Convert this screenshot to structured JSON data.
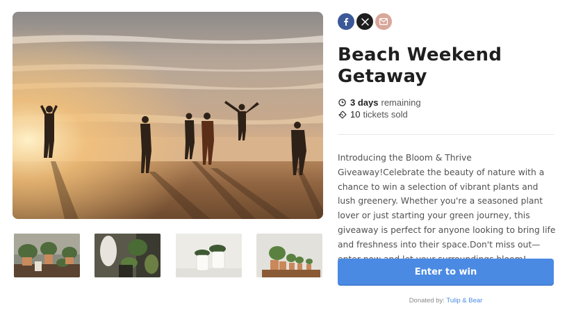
{
  "listing": {
    "title": "Beach Weekend Getaway",
    "time_value": "3 days",
    "time_suffix": "remaining",
    "tickets_value": "10",
    "tickets_suffix": "tickets sold",
    "description": "Introducing the Bloom & Thrive Giveaway!Celebrate the beauty of nature with a chance to win a selection of vibrant plants and lush greenery. Whether you're a seasoned plant lover or just starting your green journey, this giveaway is perfect for anyone looking to bring life and freshness into their space.Don't miss out—enter now and let your surroundings bloom!",
    "cta_label": "Enter to win",
    "donated_prefix": "Donated by:",
    "donor_name": "Tulip & Bear"
  },
  "share": {
    "buttons": [
      {
        "icon": "facebook-icon",
        "color": "#3b5998"
      },
      {
        "icon": "x-icon",
        "color": "#1e1e1e"
      },
      {
        "icon": "email-icon",
        "color": "#d9a79a"
      }
    ]
  },
  "colors": {
    "accent": "#4a8ae3",
    "title": "#1f1f1f",
    "text": "#505050"
  }
}
